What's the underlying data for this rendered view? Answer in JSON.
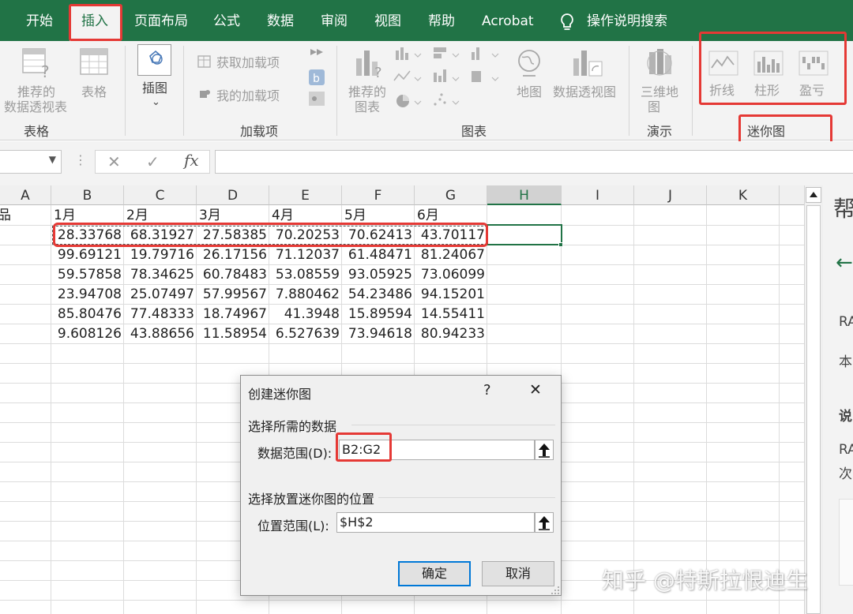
{
  "ribbon_tabs": [
    {
      "label": "开始"
    },
    {
      "label": "插入"
    },
    {
      "label": "页面布局"
    },
    {
      "label": "公式"
    },
    {
      "label": "数据"
    },
    {
      "label": "审阅"
    },
    {
      "label": "视图"
    },
    {
      "label": "帮助"
    },
    {
      "label": "Acrobat"
    },
    {
      "label": "操作说明搜索"
    }
  ],
  "ribbon": {
    "tables": {
      "group": "表格",
      "pivot_line1": "推荐的",
      "pivot_line2": "数据透视表",
      "table": "表格"
    },
    "illustrations": {
      "label": "插图",
      "chevron": "⌄"
    },
    "addins": {
      "group": "加载项",
      "get": "获取加载项",
      "mine": "我的加载项"
    },
    "charts": {
      "group": "图表",
      "recommended_line1": "推荐的",
      "recommended_line2": "图表",
      "map": "地图",
      "pivotchart": "数据透视图"
    },
    "tours": {
      "group": "演示",
      "map3d_line1": "三维地",
      "map3d_line2": "图"
    },
    "sparklines": {
      "group": "迷你图",
      "line": "折线",
      "column": "柱形",
      "winloss": "盈亏"
    }
  },
  "formula_bar": {
    "name_box_value": "",
    "cancel": "✕",
    "enter": "✓",
    "fx": "fx",
    "formula_value": ""
  },
  "sheet": {
    "columns": [
      "A",
      "B",
      "C",
      "D",
      "E",
      "F",
      "G",
      "H",
      "I",
      "J",
      "K"
    ],
    "a1": "品",
    "months": [
      "1月",
      "2月",
      "3月",
      "4月",
      "5月",
      "6月"
    ],
    "rows": [
      [
        "28.33768",
        "68.31927",
        "27.58385",
        "70.20253",
        "70.62413",
        "43.70117"
      ],
      [
        "99.69121",
        "19.79716",
        "26.17156",
        "71.12037",
        "61.48471",
        "81.24067"
      ],
      [
        "59.57858",
        "78.34625",
        "60.78483",
        "53.08559",
        "93.05925",
        "73.06099"
      ],
      [
        "23.94708",
        "25.07497",
        "57.99567",
        "7.880462",
        "54.23486",
        "94.15201"
      ],
      [
        "85.80476",
        "77.48333",
        "18.74967",
        "41.3948",
        "15.89594",
        "14.55411"
      ],
      [
        "9.608126",
        "43.88656",
        "11.58954",
        "6.527639",
        "73.94618",
        "80.94233"
      ]
    ]
  },
  "help_pane": {
    "title": "帮",
    "back": "←",
    "t1": "RA",
    "t2": "本",
    "t3": "说",
    "t4": "RA",
    "t5": "次"
  },
  "dialog": {
    "title": "创建迷你图",
    "help": "?",
    "close": "✕",
    "section_data": "选择所需的数据",
    "data_range_label": "数据范围(D):",
    "data_range_value": "B2:G2",
    "section_location": "选择放置迷你图的位置",
    "location_label": "位置范围(L):",
    "location_value": "$H$2",
    "ok": "确定",
    "cancel": "取消"
  },
  "watermark": "知乎 @特斯拉恨迪生",
  "colors": {
    "excel_green": "#217346",
    "highlight_red": "#e53935",
    "dialog_focus": "#0078d7"
  }
}
